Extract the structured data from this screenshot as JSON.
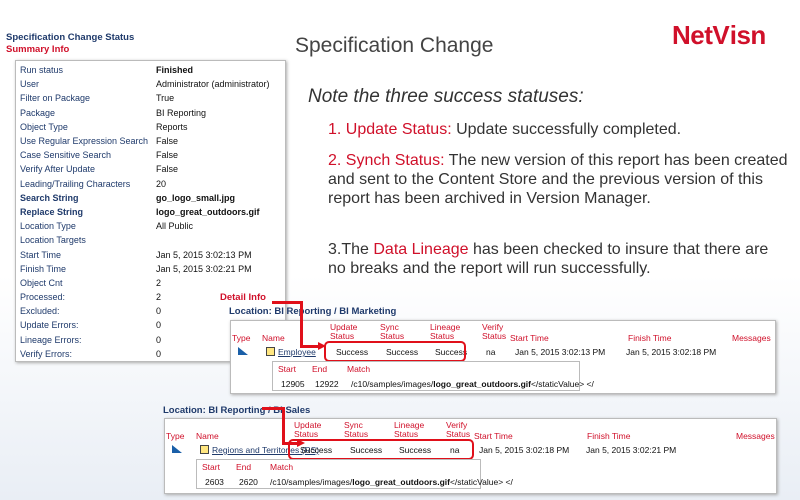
{
  "summary": {
    "title": "Specification Change Status",
    "subtitle": "Summary Info",
    "rows": [
      {
        "label": "Run status",
        "value": "Finished"
      },
      {
        "label": "User",
        "value": "Administrator (administrator)"
      },
      {
        "label": "Filter on Package",
        "value": "True"
      },
      {
        "label": "Package",
        "value": "BI Reporting"
      },
      {
        "label": "Object Type",
        "value": "Reports"
      },
      {
        "label": "Use Regular Expression Search",
        "value": "False"
      },
      {
        "label": "Case Sensitive Search",
        "value": "False"
      },
      {
        "label": "Verify After Update",
        "value": "False"
      },
      {
        "label": "Leading/Trailing Characters",
        "value": "20"
      },
      {
        "label": "Search String",
        "value": "go_logo_small.jpg"
      },
      {
        "label": "Replace String",
        "value": "logo_great_outdoors.gif"
      },
      {
        "label": "Location Type",
        "value": "All Public"
      },
      {
        "label": "Location Targets",
        "value": ""
      },
      {
        "label": "Start Time",
        "value": "Jan 5, 2015 3:02:13 PM"
      },
      {
        "label": "Finish Time",
        "value": "Jan 5, 2015 3:02:21 PM"
      },
      {
        "label": "Object Cnt",
        "value": "2"
      },
      {
        "label": "Processed:",
        "value": "2"
      },
      {
        "label": "Excluded:",
        "value": "0"
      },
      {
        "label": "Update Errors:",
        "value": "0"
      },
      {
        "label": "Lineage Errors:",
        "value": "0"
      },
      {
        "label": "Verify Errors:",
        "value": "0"
      }
    ]
  },
  "slide": {
    "title": "Specification Change",
    "logo": "NetVisn",
    "note": "Note the three success statuses:",
    "p1": {
      "lead": "1. Update Status:",
      "text": " Update successfully completed."
    },
    "p2": {
      "lead": "2. Synch Status:",
      "text": " The new version of this report has been created and sent to the Content Store and the previous version of this report has been archived in Version Manager."
    },
    "p3": {
      "pre": "3.The ",
      "lead": "Data Lineage",
      "text": " has been checked to insure that there are no breaks and the report will run successfully."
    }
  },
  "detail": {
    "label": "Detail Info",
    "headers": {
      "type": "Type",
      "name": "Name",
      "update1": "Update",
      "update2": "Status",
      "sync1": "Sync",
      "sync2": "Status",
      "lin1": "Lineage",
      "lin2": "Status",
      "ver1": "Verify",
      "ver2": "Status",
      "start": "Start Time",
      "finish": "Finish Time",
      "messages": "Messages",
      "mstart": "Start",
      "mend": "End",
      "match": "Match"
    },
    "locations": [
      {
        "location": "Location: BI Reporting / BI Marketing",
        "name": "Employee",
        "update": "Success",
        "sync": "Success",
        "lineage": "Success",
        "verify": "na",
        "start": "Jan 5, 2015 3:02:13 PM",
        "finish": "Jan 5, 2015 3:02:18 PM",
        "m_start": "12905",
        "m_end": "12922",
        "m_pre": "/c10/samples/images/",
        "m_bold": "logo_great_outdoors.gif",
        "m_post": "</staticValue> </"
      },
      {
        "location": "Location: BI Reporting / BI Sales",
        "name": "Regions and Territories (RS)",
        "update": "Success",
        "sync": "Success",
        "lineage": "Success",
        "verify": "na",
        "start": "Jan 5, 2015 3:02:18 PM",
        "finish": "Jan 5, 2015 3:02:21 PM",
        "m_start": "2603",
        "m_end": "2620",
        "m_pre": "/c10/samples/images/",
        "m_bold": "logo_great_outdoors.gif",
        "m_post": "</staticValue> </"
      }
    ]
  }
}
